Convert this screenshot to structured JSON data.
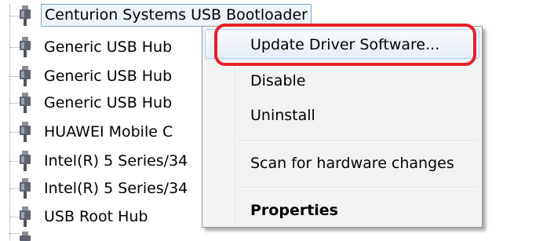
{
  "device_tree": {
    "items": [
      {
        "label": "Centurion Systems USB Bootloader",
        "icon": "usb-plug-icon",
        "selected": true
      },
      {
        "label": "Generic USB Hub",
        "icon": "usb-plug-icon"
      },
      {
        "label": "Generic USB Hub",
        "icon": "usb-plug-icon"
      },
      {
        "label": "Generic USB Hub",
        "icon": "usb-plug-icon"
      },
      {
        "label": "HUAWEI Mobile C",
        "icon": "usb-plug-icon"
      },
      {
        "label": "Intel(R) 5 Series/34",
        "icon": "usb-plug-icon"
      },
      {
        "label": "Intel(R) 5 Series/34",
        "icon": "usb-plug-icon"
      },
      {
        "label": "USB Root Hub",
        "icon": "usb-plug-icon"
      }
    ],
    "selection_color": "#eef4fb",
    "selection_border_color": "#7da2ce"
  },
  "context_menu": {
    "items": [
      {
        "label": "Update Driver Software...",
        "highlighted": true
      },
      {
        "label": "Disable"
      },
      {
        "label": "Uninstall"
      },
      {
        "separator": true
      },
      {
        "label": "Scan for hardware changes"
      },
      {
        "separator": true
      },
      {
        "label": "Properties",
        "bold": true
      }
    ],
    "background_color": "#f3f3f3",
    "highlight_border_color": "#aecff7"
  },
  "annotation": {
    "shape": "rounded-rectangle",
    "color": "#e8202a",
    "target": "Update Driver Software..."
  }
}
